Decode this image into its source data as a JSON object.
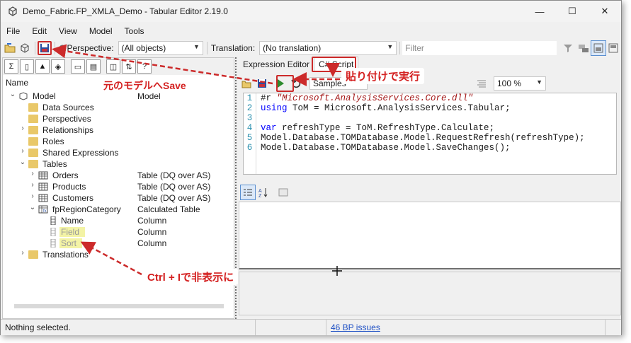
{
  "window": {
    "title": "Demo_Fabric.FP_XMLA_Demo - Tabular Editor 2.19.0"
  },
  "menu": [
    "File",
    "Edit",
    "View",
    "Model",
    "Tools"
  ],
  "toolbar": {
    "perspective_label": "Perspective:",
    "perspective_value": "(All objects)",
    "translation_label": "Translation:",
    "translation_value": "(No translation)",
    "filter_placeholder": "Filter"
  },
  "tree": {
    "header_name": "Name",
    "rows": [
      {
        "label": "Model",
        "desc": "Model"
      },
      {
        "label": "Data Sources",
        "desc": ""
      },
      {
        "label": "Perspectives",
        "desc": ""
      },
      {
        "label": "Relationships",
        "desc": ""
      },
      {
        "label": "Roles",
        "desc": ""
      },
      {
        "label": "Shared Expressions",
        "desc": ""
      },
      {
        "label": "Tables",
        "desc": ""
      },
      {
        "label": "Orders",
        "desc": "Table (DQ over AS)"
      },
      {
        "label": "Products",
        "desc": "Table (DQ over AS)"
      },
      {
        "label": "Customers",
        "desc": "Table (DQ over AS)"
      },
      {
        "label": "fpRegionCategory",
        "desc": "Calculated Table"
      },
      {
        "label": "Name",
        "desc": "Column"
      },
      {
        "label": "Field",
        "desc": "Column"
      },
      {
        "label": "Sort",
        "desc": "Column"
      },
      {
        "label": "Translations",
        "desc": ""
      }
    ]
  },
  "tabs": [
    "Expression Editor",
    "C# Script"
  ],
  "editor": {
    "samples_label": "Samples",
    "zoom": "100 %",
    "line_numbers": [
      "1",
      "2",
      "3",
      "4",
      "5",
      "6"
    ],
    "lines": [
      {
        "kw": "#r ",
        "str": "\"Microsoft.AnalysisServices.Core.dll\"",
        "rest": ""
      },
      {
        "kw": "using ",
        "str": "",
        "rest": "ToM = Microsoft.AnalysisServices.Tabular;"
      },
      {
        "kw": "",
        "str": "",
        "rest": ""
      },
      {
        "kw": "var ",
        "str": "",
        "rest": "refreshType = ToM.RefreshType.Calculate;"
      },
      {
        "kw": "",
        "str": "",
        "rest": "Model.Database.TOMDatabase.Model.RequestRefresh(refreshType);"
      },
      {
        "kw": "",
        "str": "",
        "rest": "Model.Database.TOMDatabase.Model.SaveChanges();"
      }
    ]
  },
  "status": {
    "left": "Nothing selected.",
    "issues": "46 BP issues"
  },
  "annotations": {
    "save": "元のモデルへSave",
    "run": "貼り付けで実行",
    "hide": "Ctrl + Iで非表示に"
  },
  "colors": {
    "accent": "#cc2a2a",
    "folder": "#e9c869",
    "highlight": "#f3f3a5",
    "run": "#2e8b2e"
  }
}
